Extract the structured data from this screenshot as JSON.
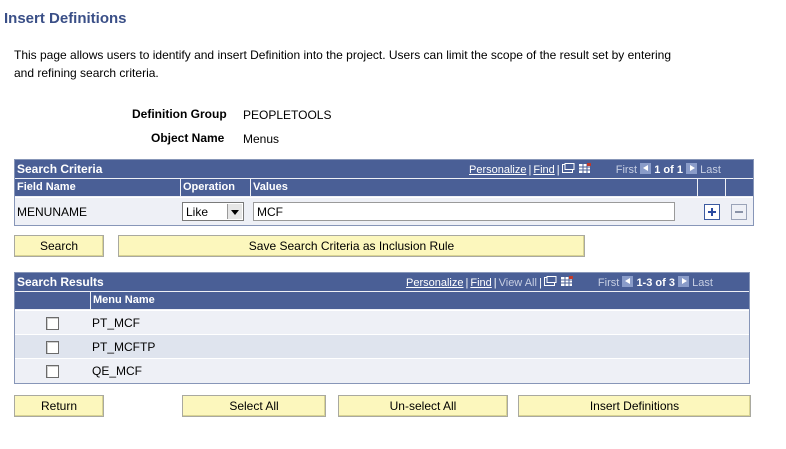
{
  "page": {
    "title": "Insert Definitions",
    "intro": "This page allows users to identify and insert Definition into the project. Users can limit the scope of the result set by entering and refining search criteria."
  },
  "fields": {
    "definition_group_label": "Definition Group",
    "definition_group_value": "PEOPLETOOLS",
    "object_name_label": "Object Name",
    "object_name_value": "Menus"
  },
  "search_criteria": {
    "title": "Search Criteria",
    "nav": {
      "personalize": "Personalize",
      "find": "Find",
      "first": "First",
      "range": "1 of 1",
      "last": "Last"
    },
    "columns": [
      "Field Name",
      "Operation",
      "Values"
    ],
    "rows": [
      {
        "field_name": "MENUNAME",
        "operation": "Like",
        "value": "MCF"
      }
    ]
  },
  "buttons": {
    "search": "Search",
    "save_rule": "Save Search Criteria as Inclusion Rule",
    "return": "Return",
    "select_all": "Select All",
    "unselect_all": "Un-select All",
    "insert_definitions": "Insert Definitions"
  },
  "search_results": {
    "title": "Search Results",
    "nav": {
      "personalize": "Personalize",
      "find": "Find",
      "view_all": "View All",
      "first": "First",
      "range": "1-3 of 3",
      "last": "Last"
    },
    "columns": [
      "Menu Name"
    ],
    "rows": [
      {
        "menu_name": "PT_MCF",
        "checked": false
      },
      {
        "menu_name": "PT_MCFTP",
        "checked": false
      },
      {
        "menu_name": "QE_MCF",
        "checked": false
      }
    ]
  },
  "icons": {
    "zoom": "zoom-icon",
    "download": "spreadsheet-icon",
    "add_row": "plus-icon",
    "delete_row": "minus-icon"
  },
  "colors": {
    "header_blue": "#4a5f96",
    "button_yellow": "#fcf7bd",
    "title_blue": "#3a4f87"
  }
}
